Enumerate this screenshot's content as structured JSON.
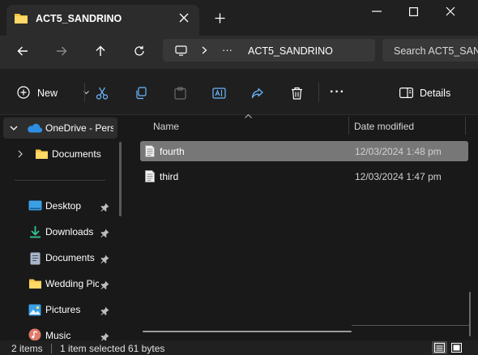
{
  "window": {
    "tab_title": "ACT5_SANDRINO",
    "controls": [
      "minimize-icon",
      "maximize-icon",
      "close-icon"
    ]
  },
  "address": {
    "more_label": "···",
    "current_folder": "ACT5_SANDRINO",
    "search_placeholder": "Search ACT5_SANDRINO"
  },
  "toolbar": {
    "new_label": "New",
    "more_label": "···",
    "details_label": "Details"
  },
  "nav": {
    "onedrive_label": "OneDrive - Personal",
    "documents_cloud_label": "Documents",
    "quick_access": [
      {
        "label": "Desktop",
        "icon": "desktop-icon",
        "pinned": true
      },
      {
        "label": "Downloads",
        "icon": "download-icon",
        "pinned": true
      },
      {
        "label": "Documents",
        "icon": "document-icon",
        "pinned": true
      },
      {
        "label": "Wedding Pictures",
        "icon": "folder-icon",
        "pinned": true
      },
      {
        "label": "Pictures",
        "icon": "pictures-icon",
        "pinned": true
      },
      {
        "label": "Music",
        "icon": "music-icon",
        "pinned": true
      }
    ]
  },
  "file_list": {
    "columns": [
      "Name",
      "Date modified"
    ],
    "rows": [
      {
        "name": "fourth",
        "date_modified": "12/03/2024 1:48 pm",
        "selected": true
      },
      {
        "name": "third",
        "date_modified": "12/03/2024 1:47 pm",
        "selected": false
      }
    ]
  },
  "status": {
    "item_count": "2 items",
    "selection": "1 item selected",
    "size": "61 bytes"
  },
  "colors": {
    "background": "#191919",
    "selected_row": "#777777",
    "folder_yellow": "#f4c542",
    "onedrive_blue": "#2e8fe0",
    "download_green": "#34c38f"
  }
}
